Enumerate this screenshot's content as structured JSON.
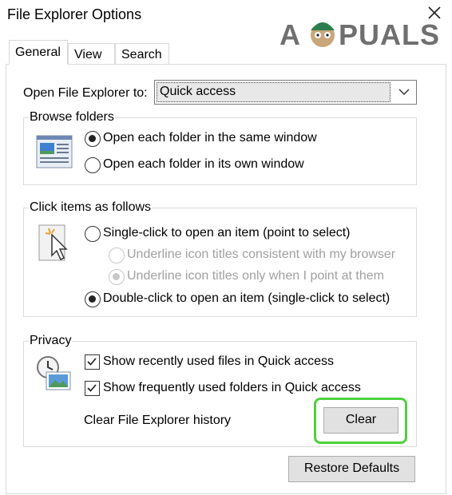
{
  "window": {
    "title": "File Explorer Options"
  },
  "watermark": {
    "text": "APPUALS"
  },
  "tabs": [
    {
      "label": "General",
      "active": true
    },
    {
      "label": "View",
      "active": false
    },
    {
      "label": "Search",
      "active": false
    }
  ],
  "open_to": {
    "label": "Open File Explorer to:",
    "value": "Quick access"
  },
  "browse": {
    "title": "Browse folders",
    "options": [
      {
        "label": "Open each folder in the same window",
        "selected": true
      },
      {
        "label": "Open each folder in its own window",
        "selected": false
      }
    ]
  },
  "click": {
    "title": "Click items as follows",
    "single": {
      "label": "Single-click to open an item (point to select)",
      "selected": false
    },
    "underline_browser": {
      "label": "Underline icon titles consistent with my browser",
      "selected": false,
      "disabled": true
    },
    "underline_point": {
      "label": "Underline icon titles only when I point at them",
      "selected": true,
      "disabled": true
    },
    "double": {
      "label": "Double-click to open an item (single-click to select)",
      "selected": true
    }
  },
  "privacy": {
    "title": "Privacy",
    "recent_files": {
      "label": "Show recently used files in Quick access",
      "checked": true
    },
    "frequent_folders": {
      "label": "Show frequently used folders in Quick access",
      "checked": true
    },
    "clear_label": "Clear File Explorer history",
    "clear_button": "Clear"
  },
  "restore_button": "Restore Defaults",
  "colors": {
    "highlight": "#4ed13e",
    "button": "#e1e1e1"
  }
}
